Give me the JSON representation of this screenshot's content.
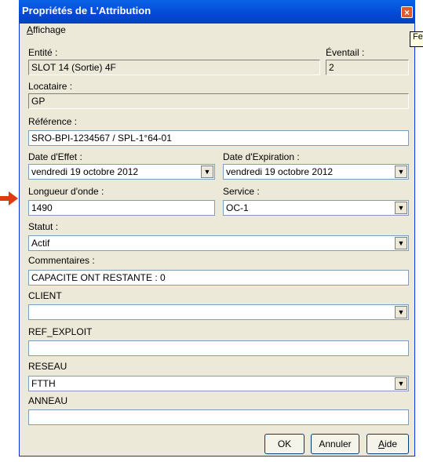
{
  "window": {
    "title": "Propriétés de L'Attribution",
    "close_label": "×"
  },
  "menu": {
    "affichage_first": "A",
    "affichage_rest": "ffichage"
  },
  "tooltip": {
    "text": "Fe"
  },
  "entite": {
    "label": "Entité :",
    "value": "SLOT 14 (Sortie) 4F"
  },
  "eventail": {
    "label": "Éventail :",
    "value": "2"
  },
  "locataire": {
    "label": "Locataire :",
    "value": "GP"
  },
  "reference": {
    "label": "Référence :",
    "value": "SRO-BPI-1234567 / SPL-1°64-01"
  },
  "date_effet": {
    "label": "Date d'Effet :",
    "value": "vendredi 19  octobre  2012"
  },
  "date_expiration": {
    "label": "Date d'Expiration :",
    "value": "vendredi 19  octobre  2012"
  },
  "longueur_onde": {
    "label": "Longueur d'onde :",
    "value": "1490"
  },
  "service": {
    "label": "Service :",
    "value": "OC-1"
  },
  "statut": {
    "label": "Statut :",
    "value": "Actif"
  },
  "commentaires": {
    "label": "Commentaires :",
    "value": "CAPACITE ONT RESTANTE : 0"
  },
  "client": {
    "label": "CLIENT",
    "value": ""
  },
  "ref_exploit": {
    "label": "REF_EXPLOIT",
    "value": ""
  },
  "reseau": {
    "label": "RESEAU",
    "value": "FTTH"
  },
  "anneau": {
    "label": "ANNEAU",
    "value": ""
  },
  "buttons": {
    "ok": "OK",
    "annuler": "Annuler",
    "aide_first": "A",
    "aide_rest": "ide"
  },
  "colors": {
    "title_bar": "#0348d6",
    "dialog_bg": "#ece9d8",
    "annotation_arrow": "#e03a12"
  },
  "icons": {
    "dropdown": "▼",
    "annotation": "red-arrow"
  }
}
